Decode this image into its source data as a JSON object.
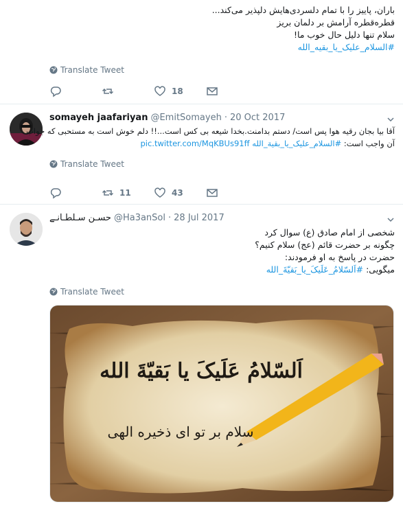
{
  "tweet1": {
    "lines": [
      "باران، پاییز را با تمام دلسردی‌هایش دلپذیر می‌کند...",
      "قطره‌قطره آرامش بر دلمان بریز",
      "سلام تنها دلیل حال خوب ما!"
    ],
    "hashtag": "#السلام_علیک_یا_بقیه_الله",
    "translate": "Translate Tweet",
    "likes": "18"
  },
  "tweet2": {
    "name": "somayeh jaafariyan",
    "handle": "@EmitSomayeh",
    "sep": "·",
    "date": "20 Oct 2017",
    "line1": "آقا بیا بجان رقیه هوا پس است/ دستم بدامنت.بخدا شیعه بی کس است...!! دلم خوش است به مستحبی که جواب",
    "line2_text": "آن واجب است:",
    "line2_hashtag": "#السلام_علیک_یا_بقیة_الله",
    "line2_link": "pic.twitter.com/MqKBUs91ff",
    "translate": "Translate Tweet",
    "retweets": "11",
    "likes": "43"
  },
  "tweet3": {
    "name": "حسـن سـلطـانـے",
    "handle": "@Ha3anSol",
    "sep": "·",
    "date": "28 Jul 2017",
    "lines": [
      "شخصی از امام صادق (ع) سوال کرد",
      "چگونه بر حضرت قائم (عج) سلام کنیم؟",
      "حضرت در پاسخ به او فرمودند:"
    ],
    "last_text": "میگویی:",
    "last_hashtag": "#اَلسّلامُ_عَلَیکَ_یا_بَقیّةَ_الله",
    "translate": "Translate Tweet",
    "image": {
      "title": "اَلسّلامُ عَلَیکَ یا بَقیّةَ الله",
      "subtitle": "سلام بر تو ای ذخیره الهی"
    }
  },
  "icons": {
    "reply": "reply-icon",
    "retweet": "retweet-icon",
    "like": "heart-icon",
    "dm": "envelope-icon",
    "globe": "globe-icon",
    "caret": "chevron-down-icon"
  },
  "colors": {
    "link": "#1b95e0",
    "muted": "#657786",
    "border": "#e6ecf0"
  }
}
